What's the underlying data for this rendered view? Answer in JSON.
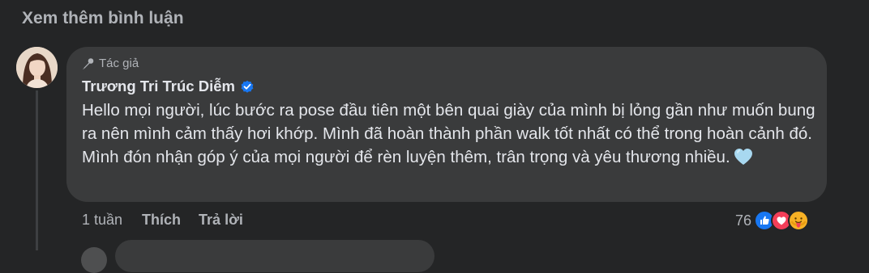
{
  "see_more": "Xem thêm bình luận",
  "comment": {
    "badge_label": "Tác giả",
    "author_name": "Trương Tri Trúc Diễm",
    "text": "Hello mọi người, lúc bước ra pose đầu tiên một bên quai giày của mình bị lỏng gần như muốn bung ra nên mình cảm thấy hơi khớp. Mình đã hoàn thành phần walk tốt nhất có thể trong hoàn cảnh đó. Mình đón nhận góp ý của mọi người để rèn luyện thêm, trân trọng và yêu thương nhiều.",
    "time": "1 tuần",
    "like_label": "Thích",
    "reply_label": "Trả lời",
    "reaction_count": "76",
    "reaction_icons": [
      "like-icon",
      "love-icon",
      "care-icon"
    ]
  },
  "colors": {
    "background": "#242526",
    "bubble": "#3a3b3c",
    "primary_text": "#e4e6eb",
    "secondary_text": "#b0b3b8",
    "verified": "#1877f2",
    "heart_emoji": "#a8d8f0"
  }
}
